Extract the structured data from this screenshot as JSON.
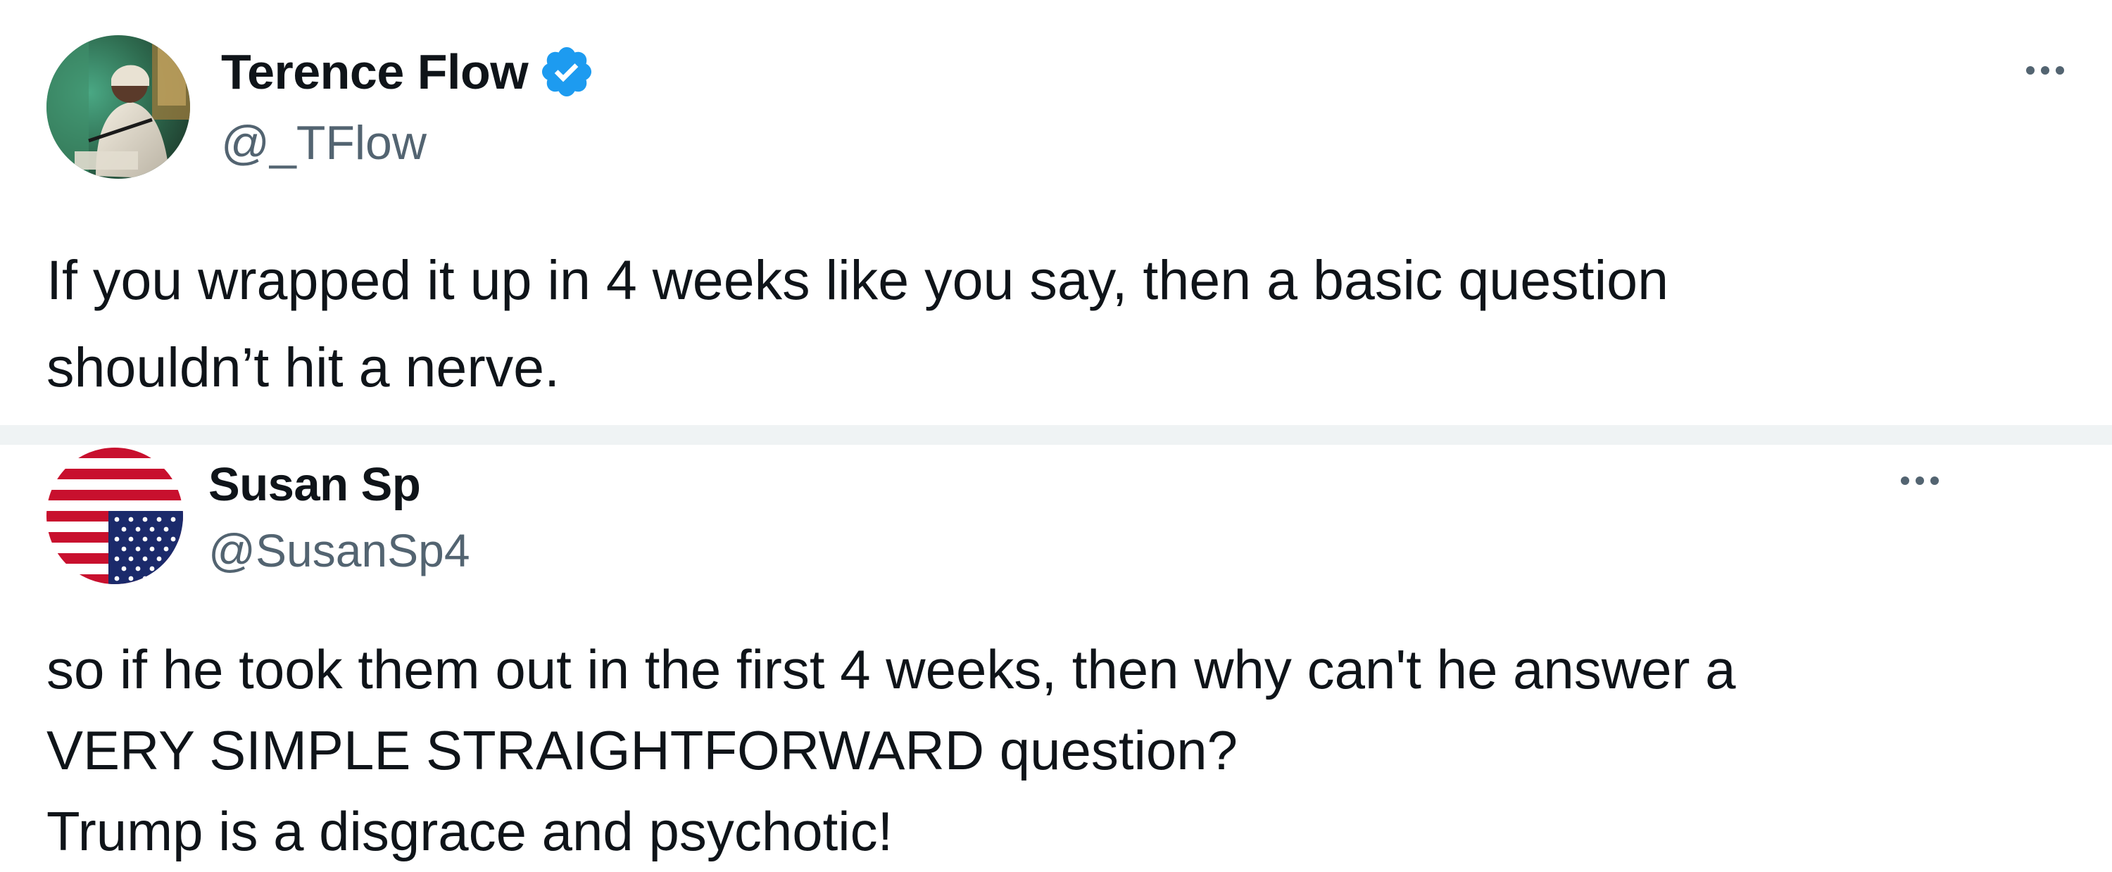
{
  "tweets": [
    {
      "display_name": "Terence Flow",
      "verified": true,
      "verified_icon": "verified-badge-icon",
      "handle": "@_TFlow",
      "avatar_icon": "profile-photo",
      "text_lines": [
        "If you wrapped it up in 4 weeks like you say, then a basic question",
        "shouldn’t hit a nerve."
      ]
    },
    {
      "display_name": "Susan Sp",
      "verified": false,
      "handle": "@SusanSp4",
      "avatar_icon": "upside-down-us-flag",
      "text_lines": [
        "so if he took them out in the first 4 weeks, then why can't he answer a",
        "VERY SIMPLE STRAIGHTFORWARD question?",
        "Trump is a disgrace and psychotic!"
      ]
    }
  ],
  "more_icon": "more-options-icon",
  "colors": {
    "text_primary": "#0f1419",
    "text_secondary": "#536471",
    "verified_blue": "#1d9bf0",
    "divider": "#eff3f4",
    "flag_red": "#c8102e",
    "flag_blue": "#1b2a6b"
  }
}
